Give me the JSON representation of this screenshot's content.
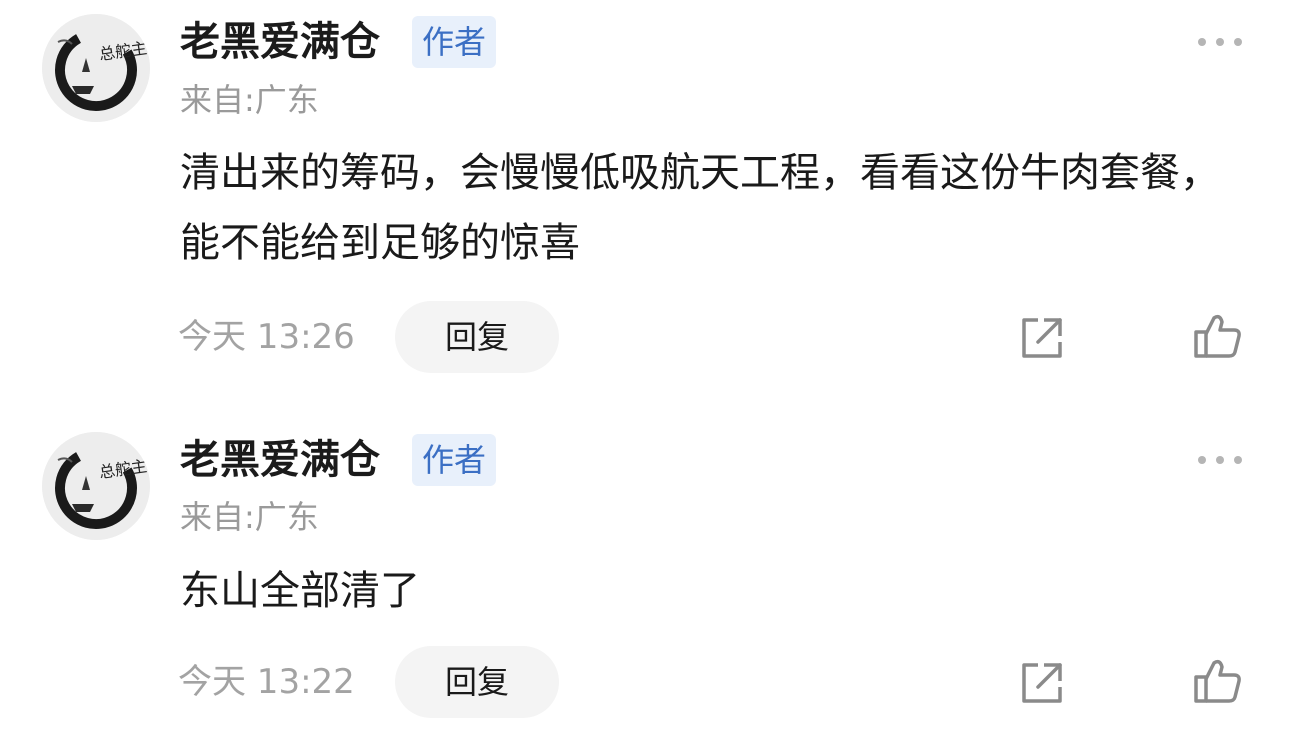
{
  "comments": [
    {
      "username": "老黑爱满仓",
      "badge": "作者",
      "location": "来自:广东",
      "content": "清出来的筹码，会慢慢低吸航天工程，看看这份牛肉套餐，能不能给到足够的惊喜",
      "time": "今天 13:26",
      "reply_label": "回复",
      "avatar_text": "总舵主"
    },
    {
      "username": "老黑爱满仓",
      "badge": "作者",
      "location": "来自:广东",
      "content": "东山全部清了",
      "time": "今天 13:22",
      "reply_label": "回复",
      "avatar_text": "总舵主"
    }
  ],
  "icons": {
    "more": "more-dots-icon",
    "share": "share-icon",
    "like": "thumbs-up-icon"
  },
  "colors": {
    "badge_text": "#3b6fc4",
    "badge_bg": "#e8f0fb",
    "muted_text": "#9a9a9a",
    "reply_bg": "#f4f4f4",
    "icon_stroke": "#8a8a8a"
  }
}
